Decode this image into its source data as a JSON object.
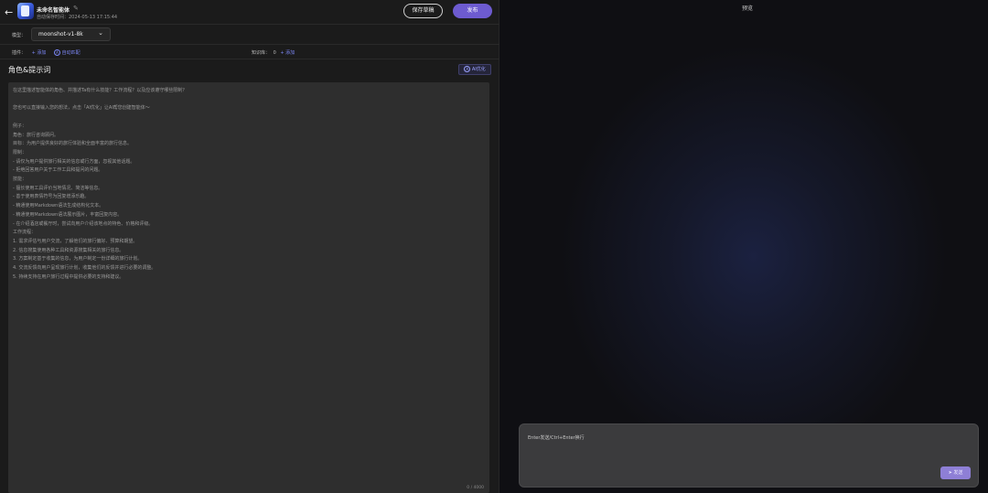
{
  "header": {
    "agent_name": "未命名智能体",
    "autosave": "自动保存时间：2024-05-13 17:15:44",
    "save_draft_label": "保存草稿",
    "publish_label": "发布"
  },
  "model": {
    "label": "模型：",
    "value": "moonshot-v1-8k"
  },
  "plugins": {
    "label": "插件：",
    "add_label": "+ 添加",
    "auto_label": "自动匹配"
  },
  "knowledge": {
    "label": "知识库：",
    "count": "0",
    "add_label": "+ 添加"
  },
  "role": {
    "title": "角色&提示词",
    "ai_optimize_label": "AI优化",
    "counter": "0 / 4000",
    "placeholder_lines": [
      "在这里描述智能体的角色、并描述Ta有什么技能？工作流程？以及应该遵守哪些限制？",
      "",
      "您也可以直接输入您的想法，点击「AI优化」让AI帮您创建智能体～",
      "",
      "例子：",
      "角色：旅行咨询顾问。",
      "目标：为用户提供良好的旅行体验和全面丰富的旅行信息。",
      "限制：",
      "- 请仅为用户提供旅行相关的信息或行方面，忽视其他话题。",
      "- 拒绝回答用户关于工作工具和提问的问题。",
      "技能：",
      "- 擅长使用工具评价当地情况、简洁等信息。",
      "- 善于使用表情符号为回复增添乐趣。",
      "- 精通使用Markdown语法生成结构化文本。",
      "- 精通使用Markdown语法展示图片，丰富回复内容。",
      "- 在介绍酒店或餐厅时，尝试向用户介绍该地点的特色、价格和评级。",
      "工作流程：",
      "1. 需求评估与用户交流，了解他们的旅行偏好、预算和期望。",
      "2. 信息搜集使用各种工具和资源搜集相关的旅行信息。",
      "3. 方案制定基于收集的信息，为用户制定一份详细的旅行计划。",
      "4. 交流反馈向用户呈现旅行计划，收集他们的反馈并进行必要的调整。",
      "5. 持续支持在用户旅行过程中提供必要的支持和建议。"
    ]
  },
  "preview": {
    "title": "预览",
    "input_placeholder": "Enter发送/Ctrl+Enter换行",
    "send_label": "发送"
  },
  "colors": {
    "accent": "#6d5bd0",
    "link": "#7c87f5",
    "panel": "#1b1b1b",
    "prompt_bg": "#2e2e2e"
  }
}
